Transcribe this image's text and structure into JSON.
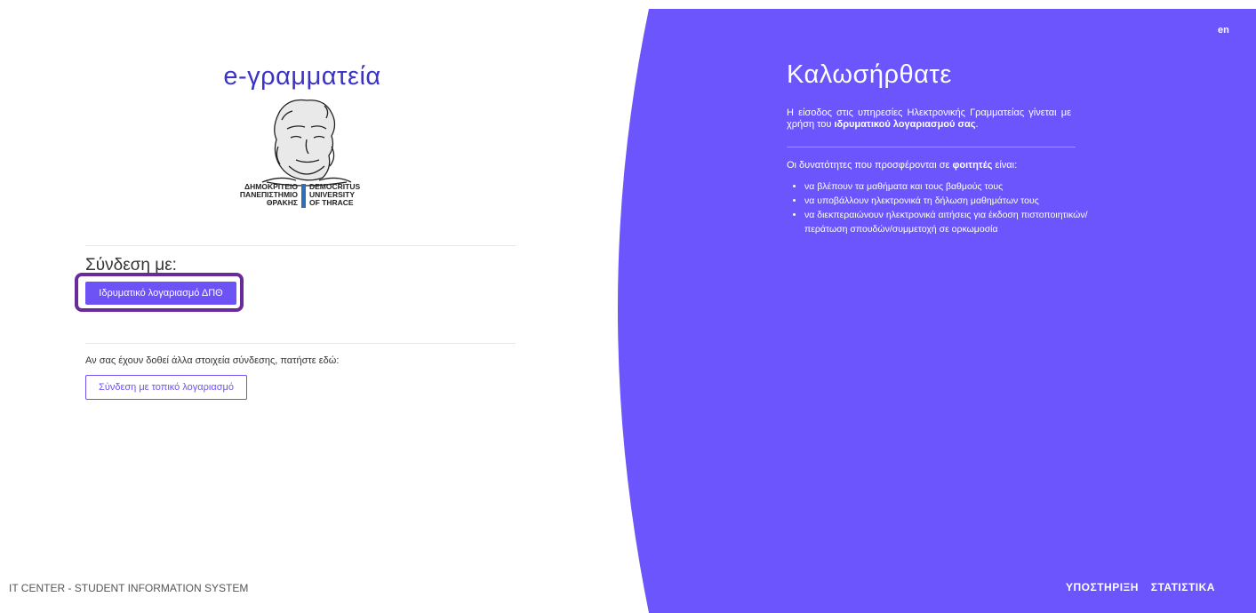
{
  "left": {
    "title": "e-γραμματεία",
    "logo_caption": {
      "greek": [
        "ΔΗΜΟΚΡΙΤΕΙΟ",
        "ΠΑΝΕΠΙΣΤΗΜΙΟ",
        "ΘΡΑΚΗΣ"
      ],
      "english": [
        "DEMOCRITUS",
        "UNIVERSITY",
        "OF THRACE"
      ]
    },
    "login_with_label": "Σύνδεση με:",
    "institutional_button": "Ιδρυματικό λογαριασμό ΔΠΘ",
    "other_credentials_text": "Αν σας έχουν δοθεί άλλα στοιχεία σύνδεσης, πατήστε εδώ:",
    "local_account_button": "Σύνδεση με τοπικό λογαριασμό",
    "footer": "IT CENTER - STUDENT INFORMATION SYSTEM"
  },
  "right": {
    "language": "en",
    "welcome": "Καλωσήρθατε",
    "intro_prefix": "Η είσοδος στις υπηρεσίες Ηλεκτρονικής Γραμματείας γίνεται με χρήση του ",
    "intro_bold": "ιδρυματικού λογαριασμού σας",
    "intro_suffix": ".",
    "features_lead_prefix": "Οι δυνατότητες που προσφέρονται σε ",
    "features_lead_bold": "φοιτητές",
    "features_lead_suffix": " είναι:",
    "features": [
      "να βλέπουν τα μαθήματα και τους βαθμούς τους",
      "να υποβάλλουν ηλεκτρονικά τη δήλωση μαθημάτων τους",
      "να διεκπεραιώνουν ηλεκτρονικά αιτήσεις για έκδοση πιστοποιητικών/περάτωση σπουδών/συμμετοχή σε ορκωμοσία"
    ],
    "footer_links": [
      "ΥΠΟΣΤΗΡΙΞΗ",
      "ΣΤΑΤΙΣΤΙΚΑ"
    ]
  },
  "colors": {
    "panel": "#6c55fc",
    "title": "#3b33c8",
    "button": "#6d52f5",
    "highlight": "#6a2a9a"
  }
}
